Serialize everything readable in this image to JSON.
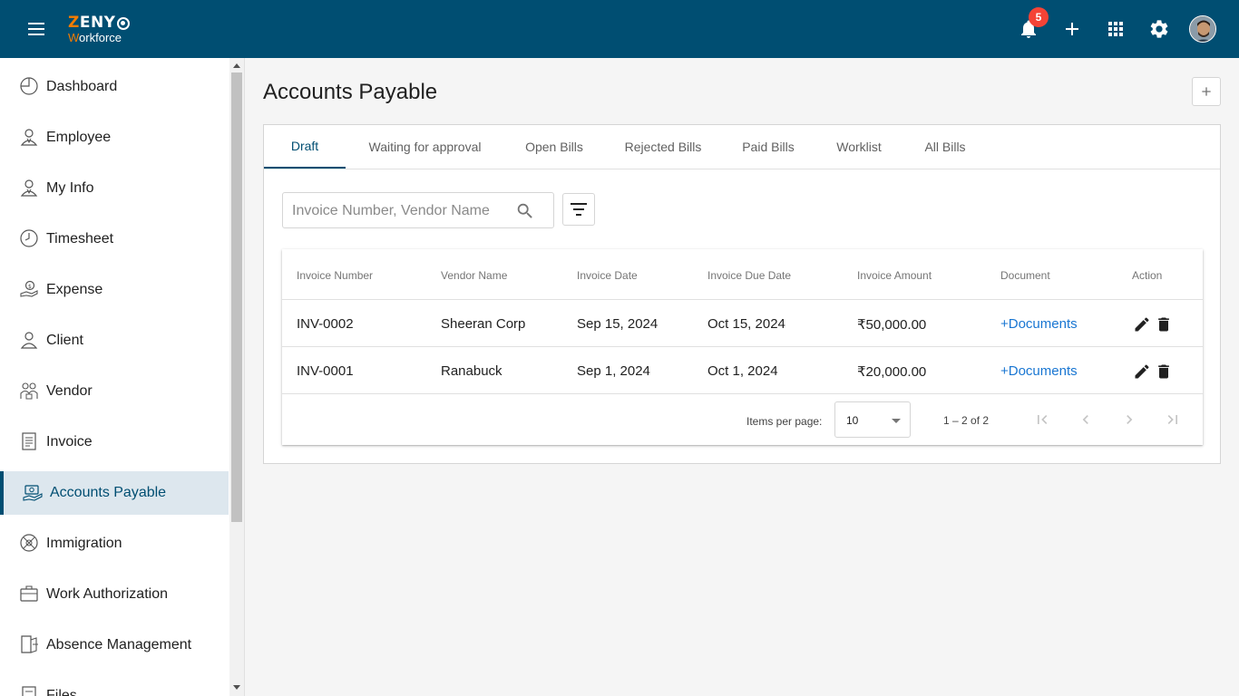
{
  "header": {
    "logo_brand": "ZENY",
    "logo_product": "Workforce",
    "notifications_count": "5",
    "icons": [
      "menu-icon",
      "bell-icon",
      "plus-icon",
      "apps-grid-icon",
      "gear-icon",
      "avatar"
    ]
  },
  "sidebar": {
    "items": [
      {
        "label": "Dashboard",
        "icon": "dashboard-icon"
      },
      {
        "label": "Employee",
        "icon": "employee-icon"
      },
      {
        "label": "My Info",
        "icon": "my-info-icon"
      },
      {
        "label": "Timesheet",
        "icon": "clock-icon"
      },
      {
        "label": "Expense",
        "icon": "expense-icon"
      },
      {
        "label": "Client",
        "icon": "client-icon"
      },
      {
        "label": "Vendor",
        "icon": "vendor-icon"
      },
      {
        "label": "Invoice",
        "icon": "invoice-icon"
      },
      {
        "label": "Accounts Payable",
        "icon": "accounts-payable-icon",
        "active": true
      },
      {
        "label": "Immigration",
        "icon": "globe-icon"
      },
      {
        "label": "Work Authorization",
        "icon": "briefcase-icon"
      },
      {
        "label": "Absence Management",
        "icon": "door-icon"
      },
      {
        "label": "Files",
        "icon": "files-icon"
      }
    ]
  },
  "main": {
    "title": "Accounts Payable",
    "tabs": [
      {
        "label": "Draft",
        "active": true
      },
      {
        "label": "Waiting for approval"
      },
      {
        "label": "Open Bills"
      },
      {
        "label": "Rejected Bills"
      },
      {
        "label": "Paid Bills"
      },
      {
        "label": "Worklist"
      },
      {
        "label": "All Bills"
      }
    ],
    "search": {
      "placeholder": "Invoice Number, Vendor Name",
      "value": ""
    },
    "table": {
      "columns": [
        "Invoice Number",
        "Vendor Name",
        "Invoice Date",
        "Invoice Due Date",
        "Invoice Amount",
        "Document",
        "Action"
      ],
      "rows": [
        {
          "invoice_number": "INV-0002",
          "vendor": "Sheeran Corp",
          "invoice_date": "Sep 15, 2024",
          "due_date": "Oct 15, 2024",
          "amount": "₹50,000.00",
          "document": "+Documents"
        },
        {
          "invoice_number": "INV-0001",
          "vendor": "Ranabuck",
          "invoice_date": "Sep 1, 2024",
          "due_date": "Oct 1, 2024",
          "amount": "₹20,000.00",
          "document": "+Documents"
        }
      ]
    },
    "pagination": {
      "items_per_page_label": "Items per page:",
      "items_per_page": "10",
      "range": "1 – 2 of 2"
    }
  },
  "colors": {
    "header": "#004e72",
    "accent": "#004e72",
    "link": "#1976d2",
    "badge": "#f44336",
    "logo_orange": "#f57c00"
  }
}
